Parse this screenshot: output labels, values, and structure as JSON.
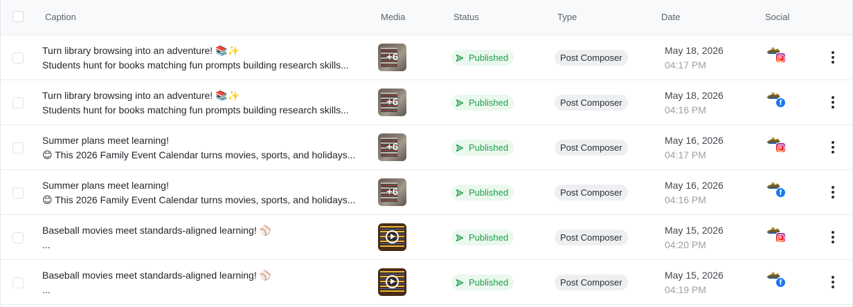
{
  "header": {
    "caption": "Caption",
    "media": "Media",
    "status": "Status",
    "type": "Type",
    "date": "Date",
    "social": "Social"
  },
  "colors": {
    "status_text": "#1f9e4a",
    "status_bg": "#eaf8ee",
    "type_bg": "#eeeff1",
    "instagram": "#c13584",
    "facebook": "#1877f2"
  },
  "rows": [
    {
      "caption_line1": "Turn library browsing into an adventure! 📚✨",
      "caption_line2": "Students hunt for books matching fun prompts building research skills...",
      "media_kind": "image",
      "media_count": "+6",
      "status": "Published",
      "type": "Post Composer",
      "date": "May 18, 2026",
      "time": "04:17 PM",
      "network": "instagram-icon"
    },
    {
      "caption_line1": "Turn library browsing into an adventure! 📚✨",
      "caption_line2": "Students hunt for books matching fun prompts building research skills...",
      "media_kind": "image",
      "media_count": "+6",
      "status": "Published",
      "type": "Post Composer",
      "date": "May 18, 2026",
      "time": "04:16 PM",
      "network": "facebook-icon"
    },
    {
      "caption_line1": "Summer plans meet learning!",
      "caption_line2": "😊 This 2026 Family Event Calendar turns movies, sports, and holidays...",
      "media_kind": "image",
      "media_count": "+6",
      "status": "Published",
      "type": "Post Composer",
      "date": "May 16, 2026",
      "time": "04:17 PM",
      "network": "instagram-icon"
    },
    {
      "caption_line1": "Summer plans meet learning!",
      "caption_line2": "😊 This 2026 Family Event Calendar turns movies, sports, and holidays...",
      "media_kind": "image",
      "media_count": "+6",
      "status": "Published",
      "type": "Post Composer",
      "date": "May 16, 2026",
      "time": "04:16 PM",
      "network": "facebook-icon"
    },
    {
      "caption_line1": "Baseball movies meet standards-aligned learning! ⚾",
      "caption_line2": "...",
      "media_kind": "video",
      "media_count": "",
      "status": "Published",
      "type": "Post Composer",
      "date": "May 15, 2026",
      "time": "04:20 PM",
      "network": "instagram-icon"
    },
    {
      "caption_line1": "Baseball movies meet standards-aligned learning! ⚾",
      "caption_line2": "...",
      "media_kind": "video",
      "media_count": "",
      "status": "Published",
      "type": "Post Composer",
      "date": "May 15, 2026",
      "time": "04:19 PM",
      "network": "facebook-icon"
    }
  ]
}
